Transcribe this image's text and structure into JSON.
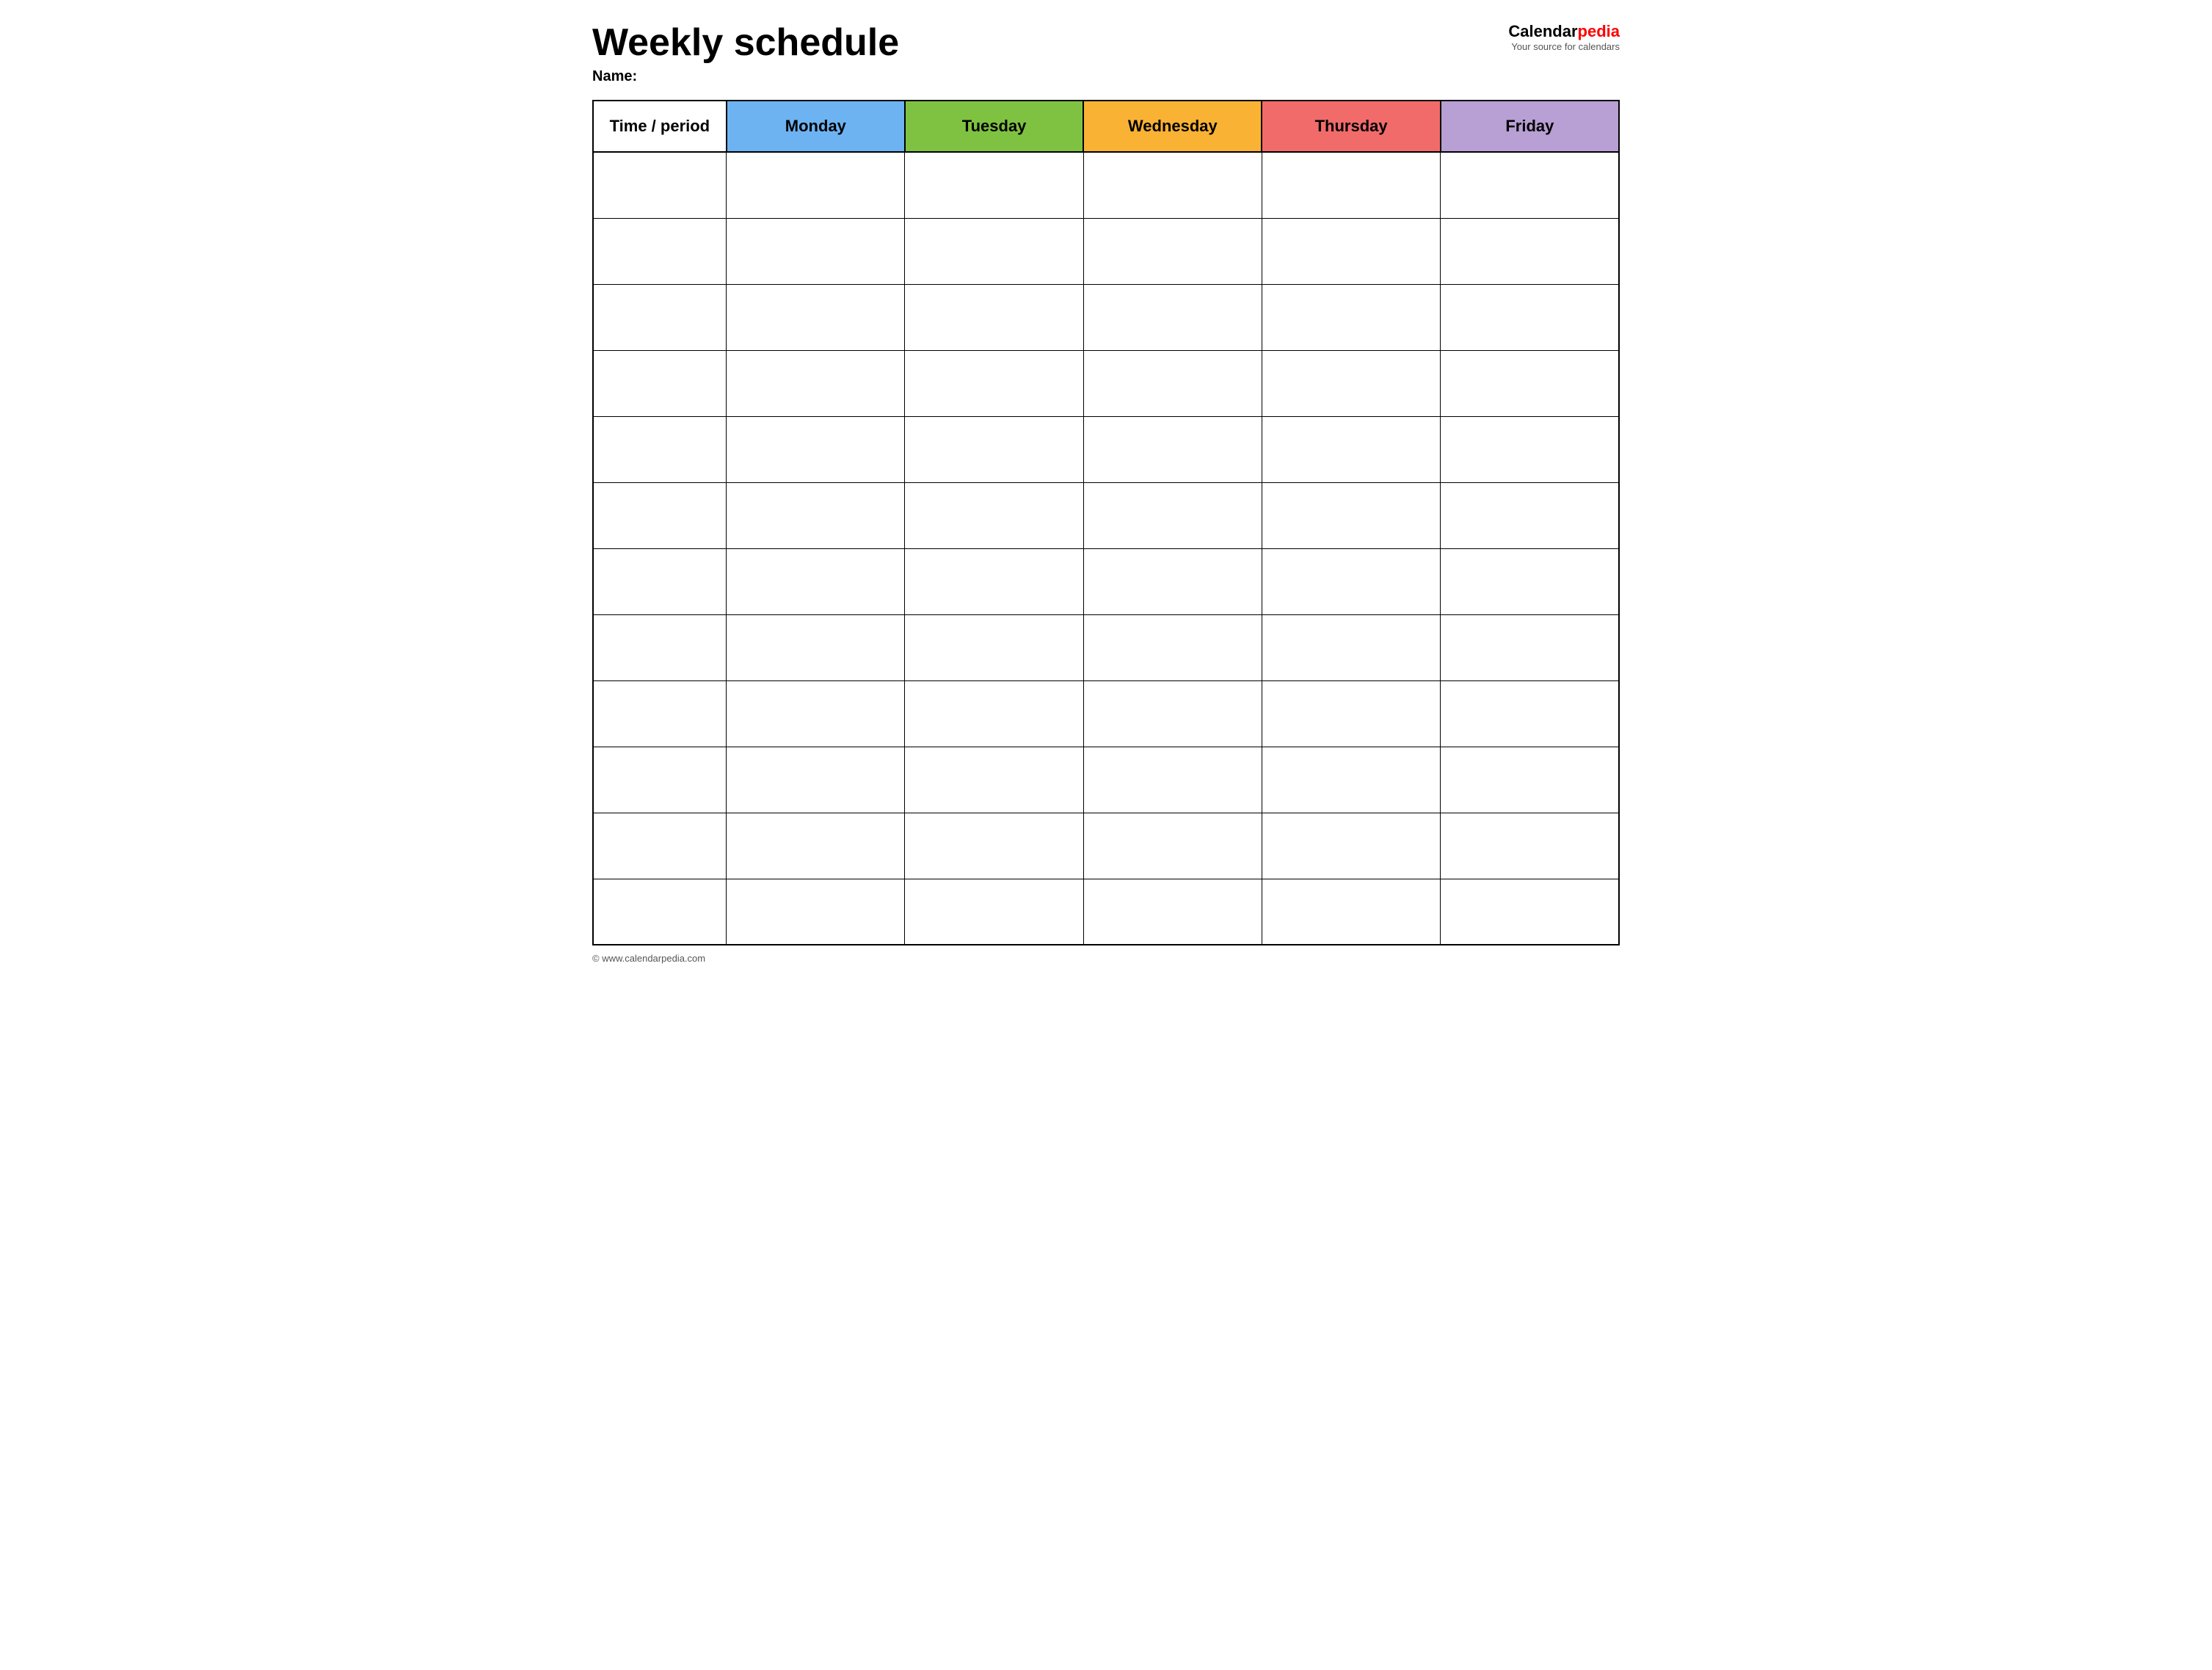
{
  "header": {
    "title": "Weekly schedule",
    "name_label": "Name:",
    "logo_calendar": "Calendar",
    "logo_pedia": "pedia",
    "logo_tagline": "Your source for calendars"
  },
  "table": {
    "columns": [
      {
        "id": "time",
        "label": "Time / period",
        "color": "#ffffff"
      },
      {
        "id": "monday",
        "label": "Monday",
        "color": "#6db3f2"
      },
      {
        "id": "tuesday",
        "label": "Tuesday",
        "color": "#7fc241"
      },
      {
        "id": "wednesday",
        "label": "Wednesday",
        "color": "#f9b234"
      },
      {
        "id": "thursday",
        "label": "Thursday",
        "color": "#f26b6b"
      },
      {
        "id": "friday",
        "label": "Friday",
        "color": "#b89fd4"
      }
    ],
    "row_count": 12
  },
  "footer": {
    "url": "© www.calendarpedia.com"
  }
}
